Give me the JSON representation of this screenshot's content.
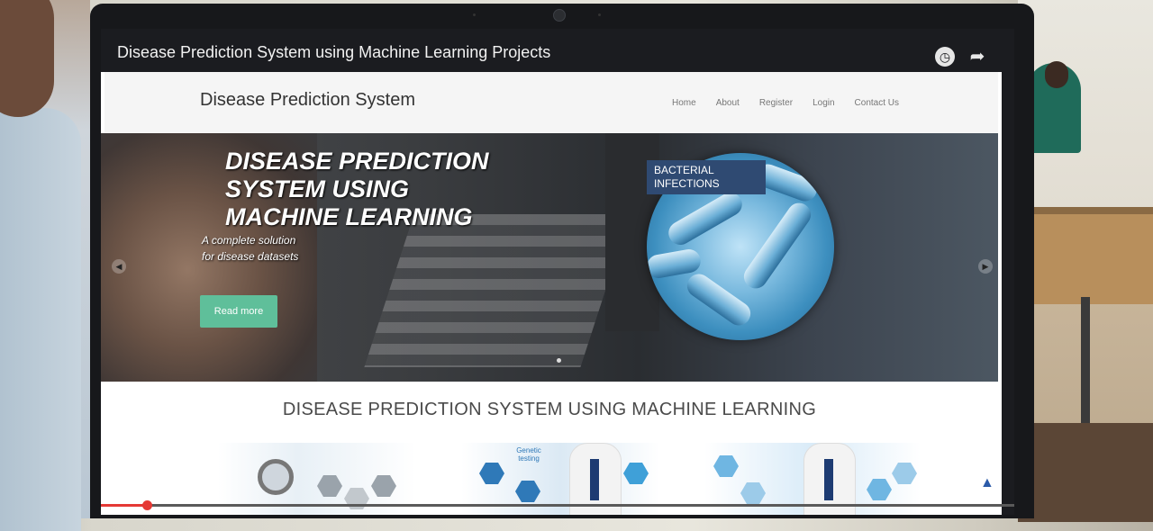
{
  "video": {
    "title": "Disease Prediction System using Machine Learning Projects",
    "progress": 0.05,
    "icons": {
      "clock": "clock-icon",
      "share": "share-icon"
    }
  },
  "site": {
    "brand": "Disease Prediction System",
    "nav": [
      "Home",
      "About",
      "Register",
      "Login",
      "Contact Us"
    ],
    "hero": {
      "title": "DISEASE PREDICTION SYSTEM USING MACHINE LEARNING",
      "subtitle_line1": "A complete solution",
      "subtitle_line2": "for disease datasets",
      "button": "Read more",
      "badge": "BACTERIAL INFECTIONS",
      "prev_icon": "chevron-left-icon",
      "next_icon": "chevron-right-icon"
    },
    "section_title": "DISEASE PREDICTION SYSTEM USING MACHINE LEARNING",
    "thumb_2_label": "Genetic testing",
    "accent": "#5fbf9a",
    "badge_color": "#2f4a72"
  }
}
